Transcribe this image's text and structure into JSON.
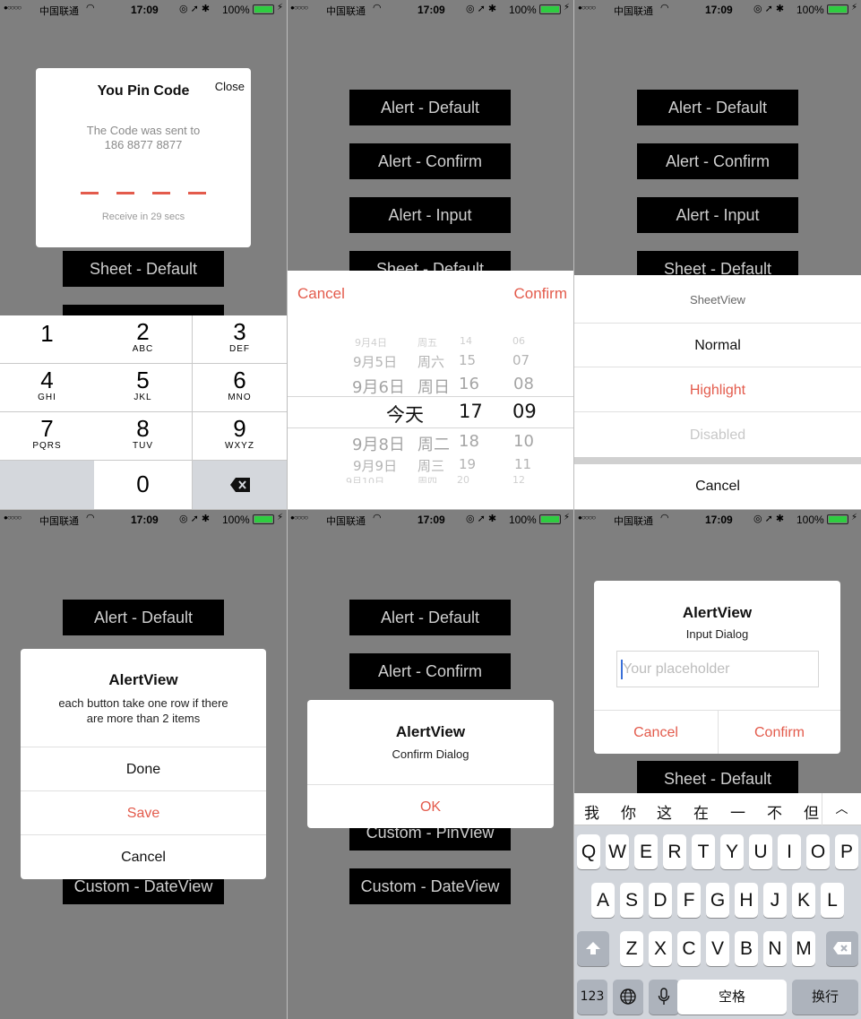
{
  "status_bar": {
    "carrier": "中国联通",
    "time": "17:09",
    "battery": "100%"
  },
  "main_buttons": [
    "Alert - Default",
    "Alert - Confirm",
    "Alert - Input",
    "Sheet - Default",
    "Custom - PinView",
    "Custom - DateView"
  ],
  "pin_view": {
    "title": "You Pin Code",
    "close": "Close",
    "message_line1": "The Code was sent to",
    "message_line2": "186 8877 8877",
    "receive": "Receive in 29 secs",
    "keys": [
      {
        "num": "1",
        "letters": ""
      },
      {
        "num": "2",
        "letters": "ABC"
      },
      {
        "num": "3",
        "letters": "DEF"
      },
      {
        "num": "4",
        "letters": "GHI"
      },
      {
        "num": "5",
        "letters": "JKL"
      },
      {
        "num": "6",
        "letters": "MNO"
      },
      {
        "num": "7",
        "letters": "PQRS"
      },
      {
        "num": "8",
        "letters": "TUV"
      },
      {
        "num": "9",
        "letters": "WXYZ"
      },
      {
        "num": "0",
        "letters": ""
      }
    ],
    "delete_icon": "backspace-icon"
  },
  "date_view": {
    "cancel": "Cancel",
    "confirm": "Confirm",
    "rows": [
      {
        "date": "9月4日",
        "weekday": "周五",
        "hour": "14",
        "minute": "06"
      },
      {
        "date": "9月5日",
        "weekday": "周六",
        "hour": "15",
        "minute": "07"
      },
      {
        "date": "9月6日",
        "weekday": "周日",
        "hour": "16",
        "minute": "08"
      },
      {
        "date": "",
        "weekday": "今天",
        "hour": "17",
        "minute": "09"
      },
      {
        "date": "9月8日",
        "weekday": "周二",
        "hour": "18",
        "minute": "10"
      },
      {
        "date": "9月9日",
        "weekday": "周三",
        "hour": "19",
        "minute": "11"
      },
      {
        "date": "9月10日",
        "weekday": "周四",
        "hour": "20",
        "minute": "12"
      }
    ]
  },
  "sheet_view": {
    "title": "SheetView",
    "normal": "Normal",
    "highlight": "Highlight",
    "disabled": "Disabled",
    "cancel": "Cancel"
  },
  "alert_default": {
    "title": "AlertView",
    "message_line1": "each button take one row if there",
    "message_line2": "are more than 2 items",
    "buttons": [
      "Done",
      "Save",
      "Cancel"
    ]
  },
  "alert_confirm": {
    "title": "AlertView",
    "message": "Confirm Dialog",
    "ok": "OK"
  },
  "alert_input": {
    "title": "AlertView",
    "message": "Input Dialog",
    "placeholder": "Your placeholder",
    "cancel": "Cancel",
    "confirm": "Confirm"
  },
  "keyboard": {
    "candidates": [
      "我",
      "你",
      "这",
      "在",
      "一",
      "不",
      "但"
    ],
    "row1": [
      "Q",
      "W",
      "E",
      "R",
      "T",
      "Y",
      "U",
      "I",
      "O",
      "P"
    ],
    "row2": [
      "A",
      "S",
      "D",
      "F",
      "G",
      "H",
      "J",
      "K",
      "L"
    ],
    "row3": [
      "Z",
      "X",
      "C",
      "V",
      "B",
      "N",
      "M"
    ],
    "num_key": "123",
    "space": "空格",
    "return": "换行"
  },
  "colors": {
    "accent": "#e35b4c",
    "overlay": "#7f7f7f",
    "button_bg": "#000000",
    "button_text": "#cfcfcf",
    "muted": "#bdbdbd"
  }
}
